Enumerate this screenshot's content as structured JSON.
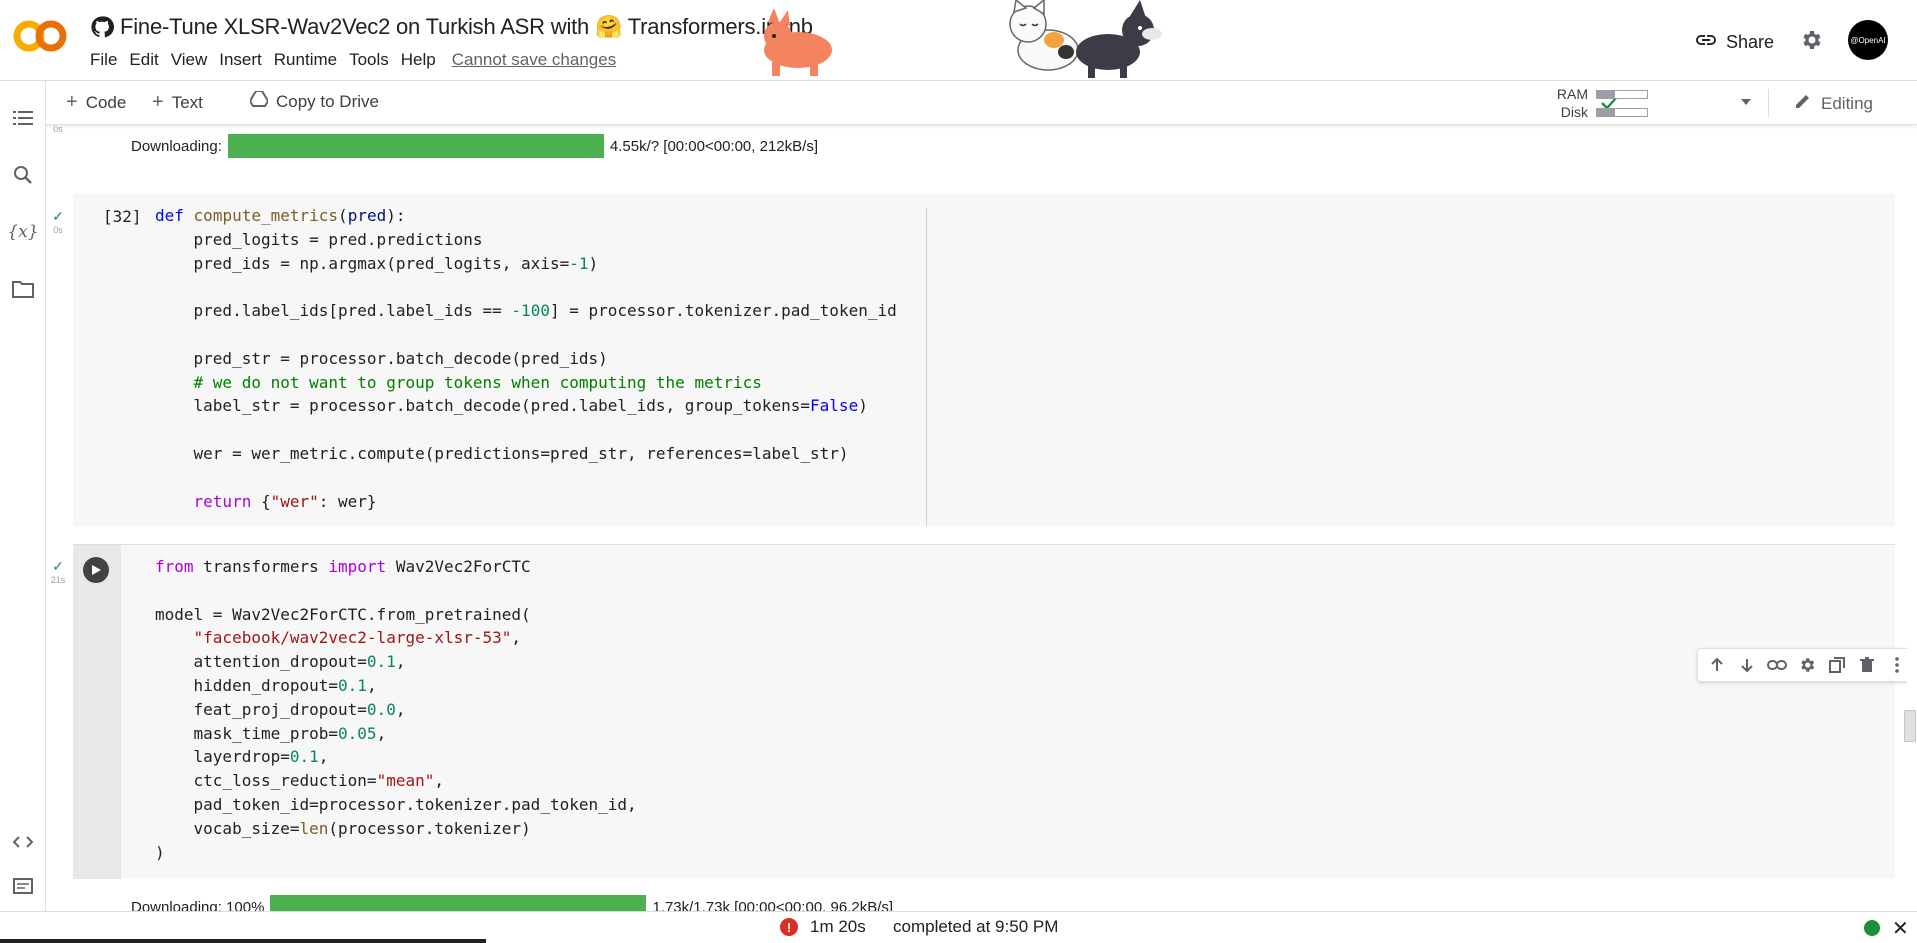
{
  "app": {
    "logo_text": "CO",
    "notebook_title": "Fine-Tune XLSR-Wav2Vec2 on Turkish ASR with 🤗 Transformers.ipynb",
    "menu": [
      "File",
      "Edit",
      "View",
      "Insert",
      "Runtime",
      "Tools",
      "Help"
    ],
    "cannot_save": "Cannot save changes",
    "share_label": "Share",
    "avatar_text": "@OpenAI"
  },
  "toolbar": {
    "code_label": "Code",
    "text_label": "Text",
    "copy_to_drive_label": "Copy to Drive",
    "ram_label": "RAM",
    "disk_label": "Disk",
    "ram_fraction": 0.35,
    "disk_fraction": 0.35,
    "editing_label": "Editing"
  },
  "cells": {
    "prev_output": {
      "status_time": "0s",
      "prefix": "Downloading:",
      "progress_fraction": 1.0,
      "suffix": "4.55k/? [00:00<00:00, 212kB/s]"
    },
    "cell32": {
      "exec_count": "[32]",
      "status_time": "0s"
    },
    "cell_model": {
      "status_time": "21s",
      "output_prefix": "Downloading: 100%",
      "output_progress_fraction": 1.0,
      "output_suffix": "1.73k/1.73k [00:00<00:00, 96.2kB/s]"
    }
  },
  "status": {
    "duration": "1m 20s",
    "completed": "completed at 9:50 PM"
  },
  "colors": {
    "progress_green": "#4caf50",
    "status_ok": "#1e8e3e",
    "status_error": "#d93025",
    "logo_orange": "#f9ab00"
  }
}
